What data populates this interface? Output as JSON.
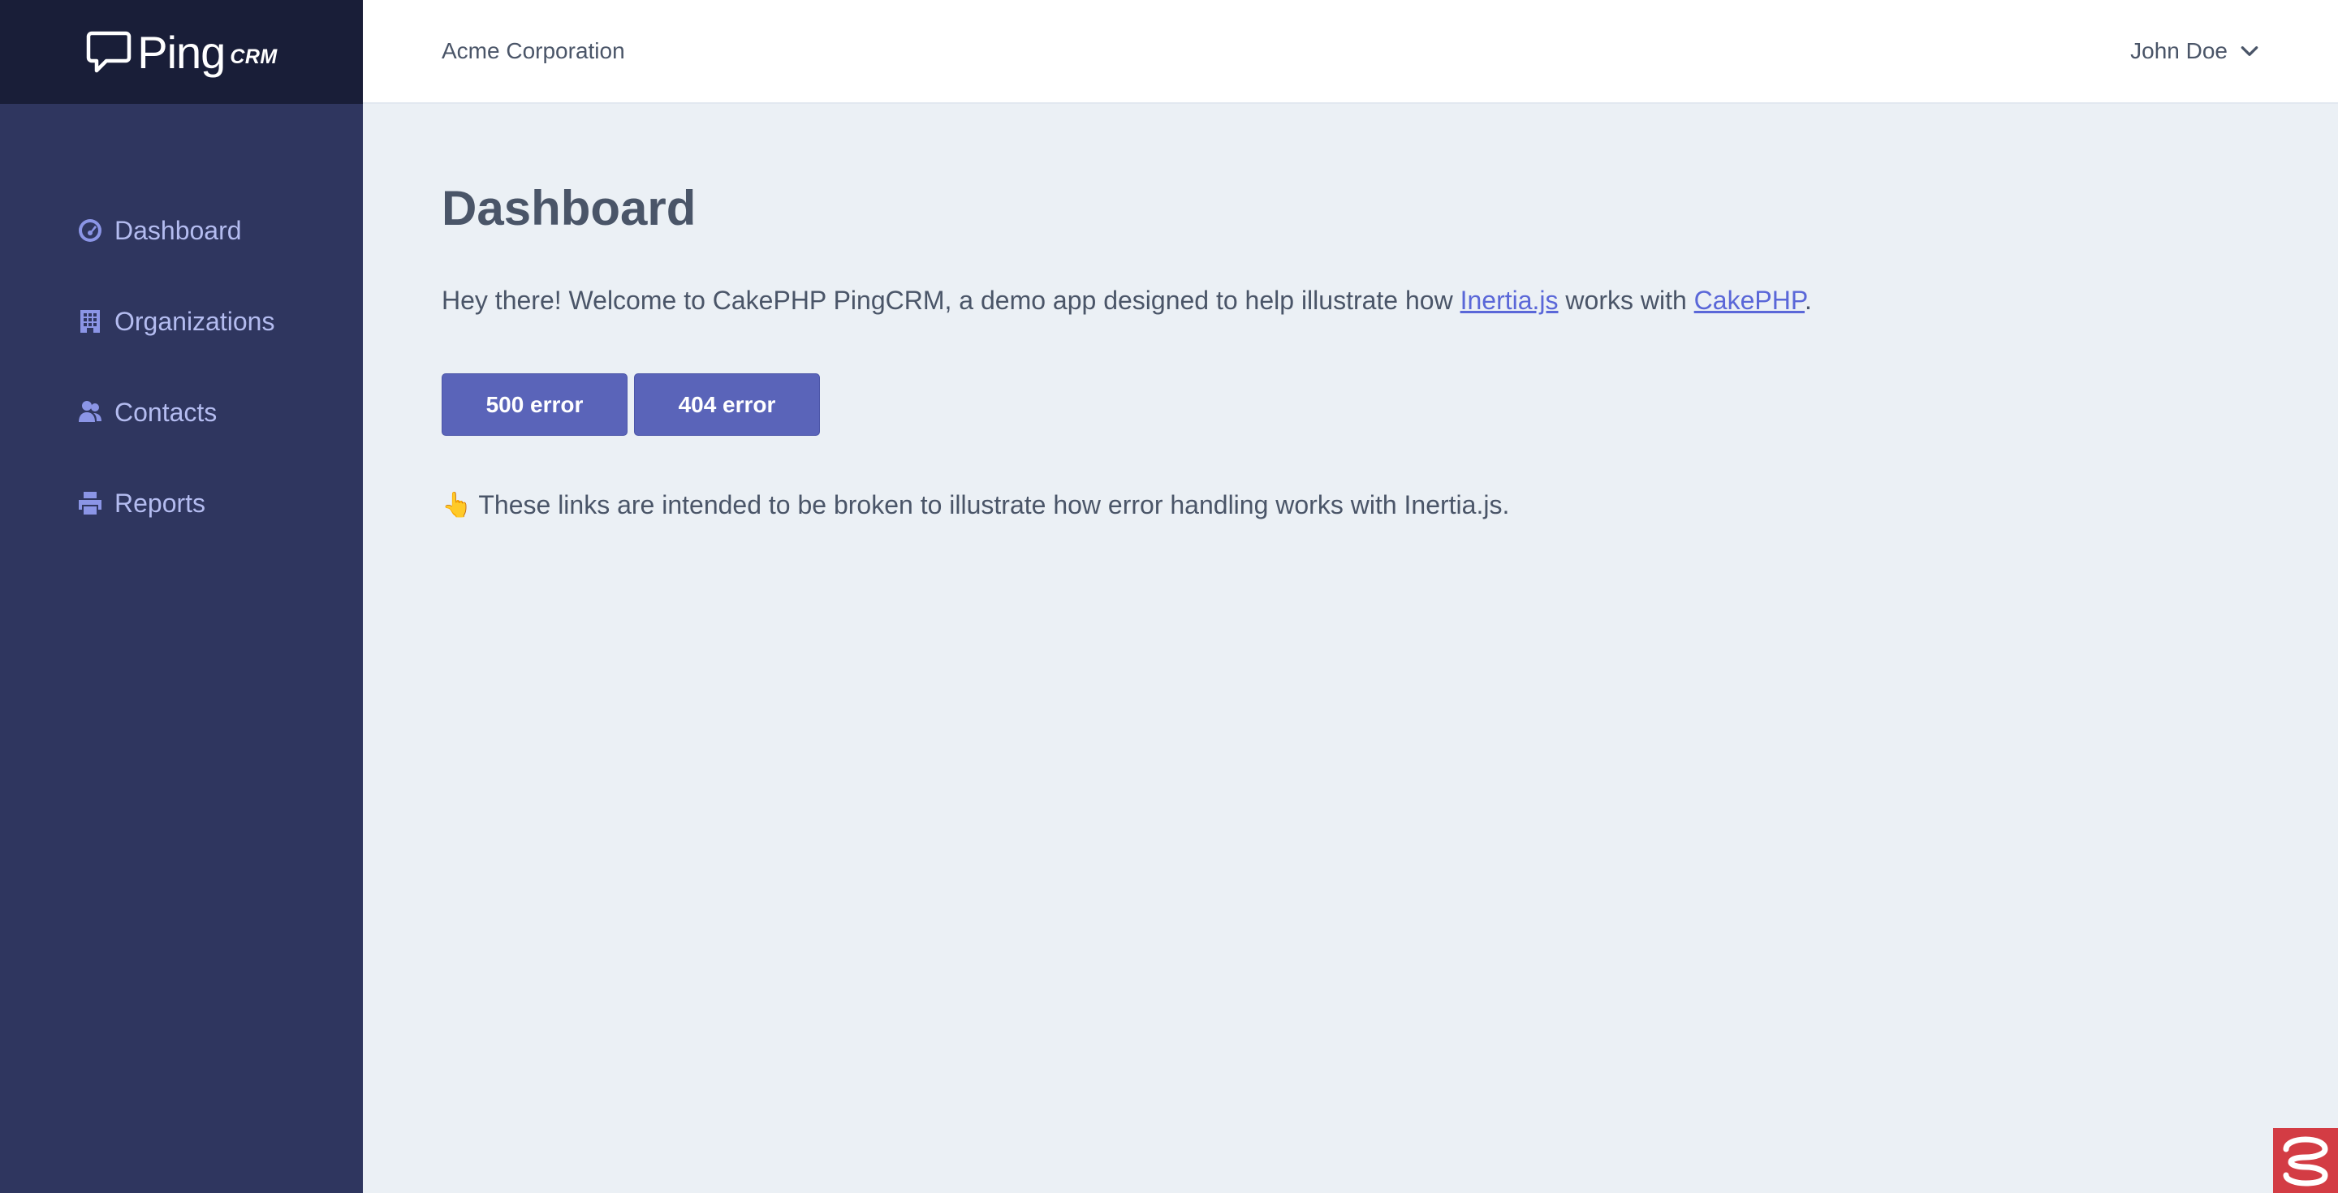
{
  "brand": {
    "name": "Ping",
    "suffix": "CRM"
  },
  "header": {
    "organization": "Acme Corporation",
    "user_name": "John Doe"
  },
  "sidebar": {
    "items": [
      {
        "label": "Dashboard",
        "icon": "dashboard-icon"
      },
      {
        "label": "Organizations",
        "icon": "building-icon"
      },
      {
        "label": "Contacts",
        "icon": "users-icon"
      },
      {
        "label": "Reports",
        "icon": "printer-icon"
      }
    ]
  },
  "main": {
    "title": "Dashboard",
    "intro": {
      "before": "Hey there! Welcome to CakePHP PingCRM, a demo app designed to help illustrate how ",
      "link1": "Inertia.js",
      "middle": " works with ",
      "link2": "CakePHP",
      "after": "."
    },
    "buttons": {
      "error500": "500 error",
      "error404": "404 error"
    },
    "note": {
      "emoji": "👆",
      "text": "These links are intended to be broken to illustrate how error handling works with Inertia.js."
    }
  },
  "colors": {
    "sidebar_bg": "#2f365f",
    "logo_bg": "#191e38",
    "main_bg": "#ebf0f5",
    "accent": "#5a64b9",
    "link": "#5a67d8",
    "badge": "#d33c44"
  }
}
